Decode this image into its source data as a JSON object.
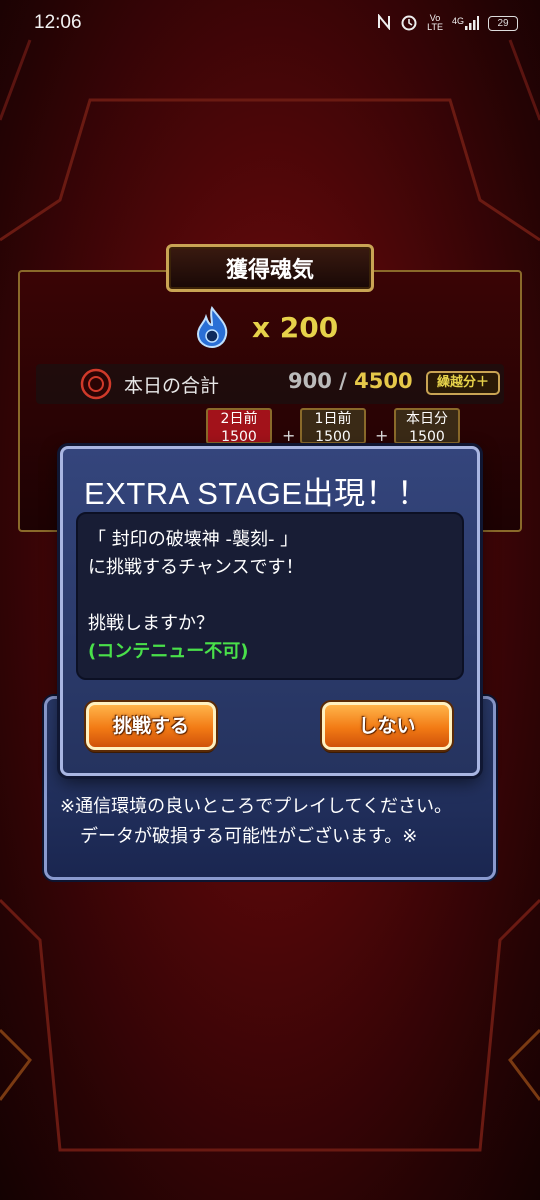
{
  "status_bar": {
    "time": "12:06",
    "icons": [
      "nfc-icon",
      "alarm-icon",
      "volte-icon",
      "signal-4g-icon",
      "battery-icon"
    ],
    "network": "4G",
    "volte_line1": "Vo",
    "volte_line2": "LTE",
    "battery": "29"
  },
  "reward": {
    "title": "獲得魂気",
    "soul_count": "x 200",
    "total_label": "本日の合計",
    "total_current": "900",
    "total_separator": "/",
    "total_max": "4500",
    "carry_label": "繰越分＋",
    "days": [
      {
        "label": "2日前",
        "value": "1500"
      },
      {
        "label": "1日前",
        "value": "1500"
      },
      {
        "label": "本日分",
        "value": "1500"
      }
    ],
    "plus": "+"
  },
  "dialog": {
    "title": "EXTRA STAGE出現！！",
    "line1": "「 封印の破壊神 -襲刻- 」",
    "line2": "に挑戦するチャンスです！",
    "line3": "挑戦しますか？",
    "note": "(コンテニュー不可)",
    "yes_label": "挑戦する",
    "no_label": "しない"
  },
  "notice": {
    "line1": "※通信環境の良いところでプレイしてください。",
    "line2": "データが破損する可能性がございます。※"
  },
  "colors": {
    "background": "#4a0608",
    "dialog": "#2c3b6d",
    "button": "#f27a14",
    "gold": "#e6d24a",
    "note_green": "#49e04a"
  }
}
